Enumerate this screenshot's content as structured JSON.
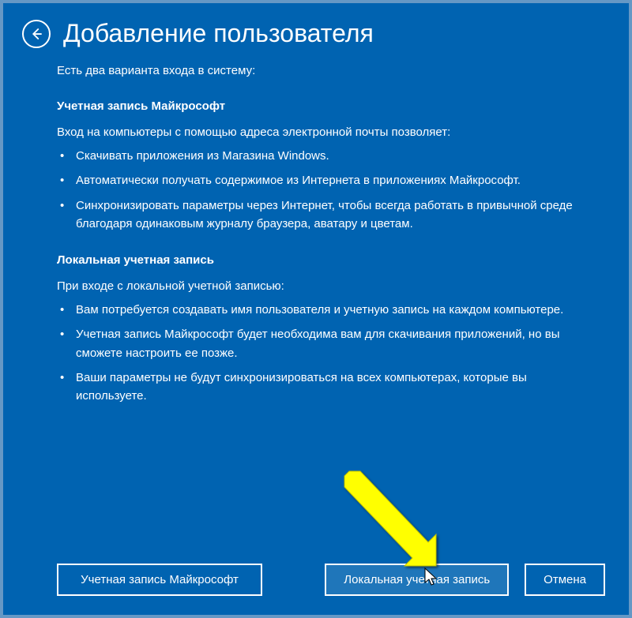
{
  "header": {
    "title": "Добавление пользователя"
  },
  "intro": "Есть два варианта входа в систему:",
  "section1": {
    "heading": "Учетная запись Майкрософт",
    "desc": "Вход на компьютеры с помощью адреса электронной почты позволяет:",
    "items": [
      "Скачивать приложения из Магазина Windows.",
      "Автоматически получать содержимое из Интернета в приложениях Майкрософт.",
      "Синхронизировать параметры через Интернет, чтобы всегда работать в привычной среде благодаря одинаковым журналу браузера, аватару и цветам."
    ]
  },
  "section2": {
    "heading": "Локальная учетная запись",
    "desc": "При входе с локальной учетной записью:",
    "items": [
      "Вам потребуется создавать имя пользователя и учетную запись на каждом компьютере.",
      "Учетная запись Майкрософт будет необходима вам для скачивания приложений, но вы сможете настроить ее позже.",
      "Ваши параметры не будут синхронизироваться на всех компьютерах, которые вы используете."
    ]
  },
  "buttons": {
    "microsoft": "Учетная запись Майкрософт",
    "local": "Локальная учетная запись",
    "cancel": "Отмена"
  },
  "colors": {
    "background": "#0063B1",
    "text": "#ffffff",
    "arrow": "#FFFF00"
  }
}
